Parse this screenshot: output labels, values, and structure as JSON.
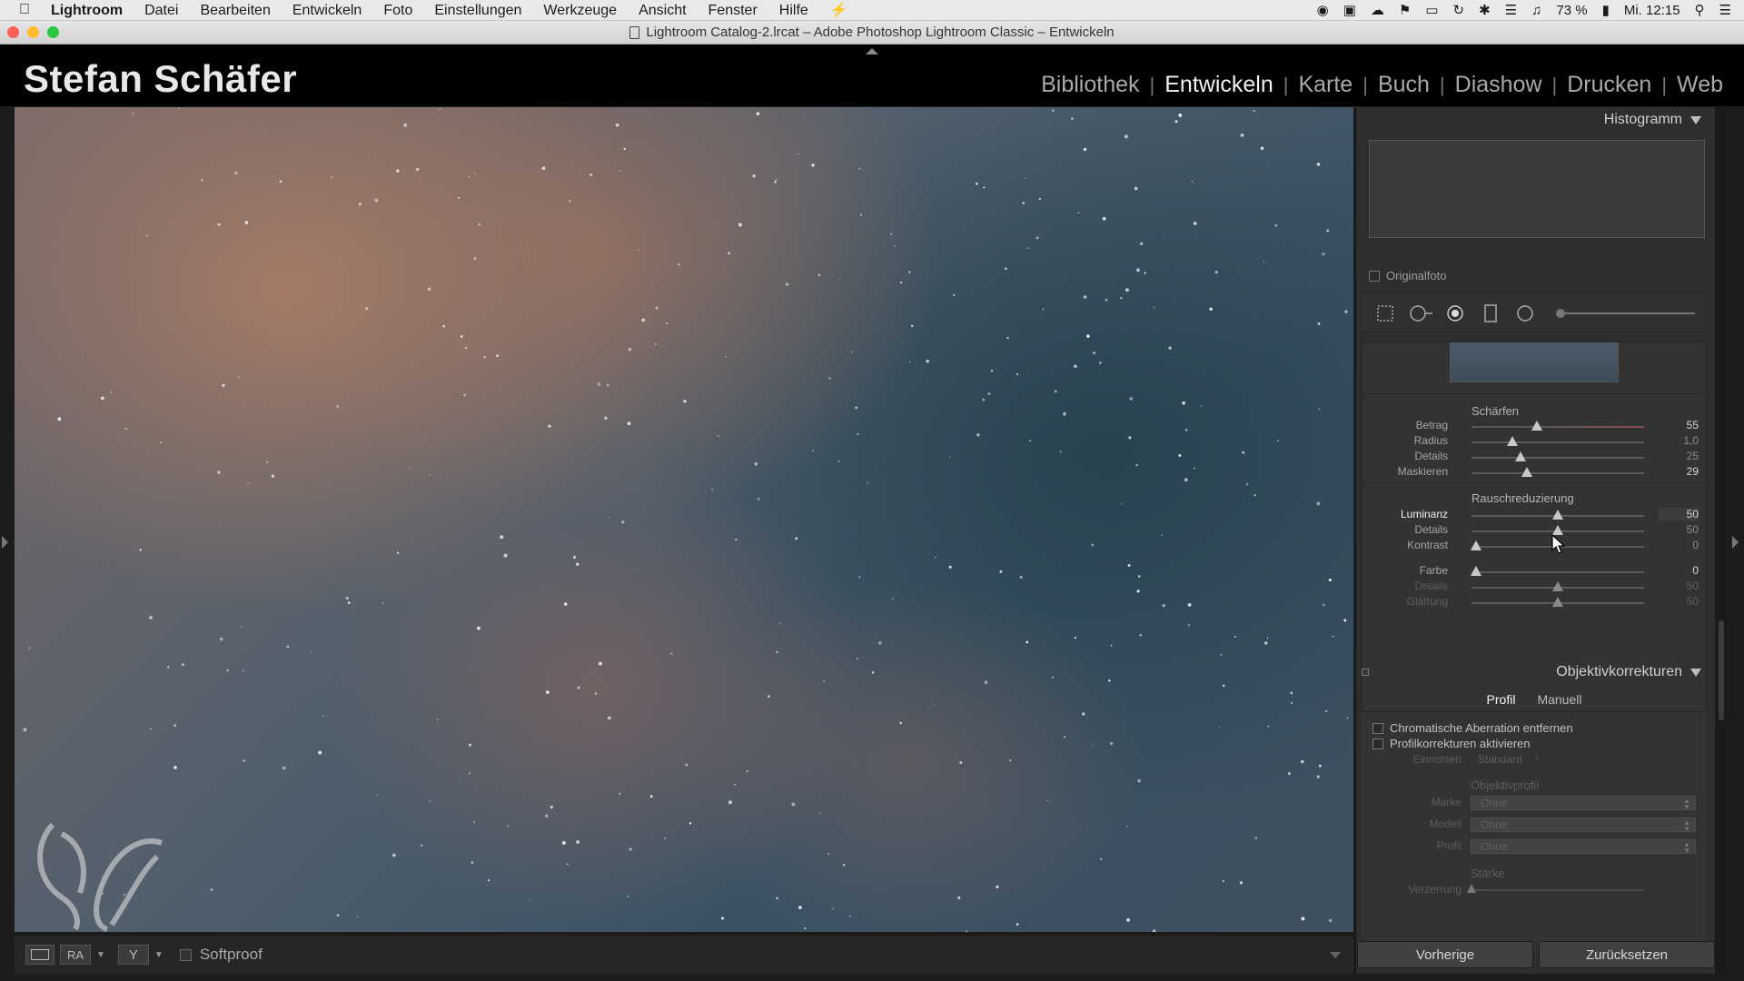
{
  "menubar": {
    "app": "Lightroom",
    "items": [
      "Datei",
      "Bearbeiten",
      "Entwickeln",
      "Foto",
      "Einstellungen",
      "Werkzeuge",
      "Ansicht",
      "Fenster",
      "Hilfe"
    ],
    "battery": "73 %",
    "clock": "Mi. 12:15"
  },
  "window": {
    "title": "Lightroom Catalog-2.lrcat – Adobe Photoshop Lightroom Classic – Entwickeln"
  },
  "identity_plate": "Stefan Schäfer",
  "modules": [
    {
      "label": "Bibliothek",
      "active": false
    },
    {
      "label": "Entwickeln",
      "active": true
    },
    {
      "label": "Karte",
      "active": false
    },
    {
      "label": "Buch",
      "active": false
    },
    {
      "label": "Diashow",
      "active": false
    },
    {
      "label": "Drucken",
      "active": false
    },
    {
      "label": "Web",
      "active": false
    }
  ],
  "toolbar": {
    "view_button": "RA",
    "softproof_label": "Softproof"
  },
  "histogram": {
    "header": "Histogramm",
    "original_photo_label": "Originalfoto"
  },
  "detail": {
    "sharpen_title": "Schärfen",
    "sharpen": [
      {
        "label": "Betrag",
        "value": "55",
        "pct": 0.37
      },
      {
        "label": "Radius",
        "value": "1,0",
        "pct": 0.22
      },
      {
        "label": "Details",
        "value": "25",
        "pct": 0.27
      },
      {
        "label": "Maskieren",
        "value": "29",
        "pct": 0.31
      }
    ],
    "noise_title": "Rauschreduzierung",
    "noise": [
      {
        "label": "Luminanz",
        "value": "50",
        "pct": 0.5
      },
      {
        "label": "Details",
        "value": "50",
        "pct": 0.5
      },
      {
        "label": "Kontrast",
        "value": "0",
        "pct": 0.0
      }
    ],
    "color": [
      {
        "label": "Farbe",
        "value": "0",
        "pct": 0.0
      },
      {
        "label": "Details",
        "value": "50",
        "pct": 0.5
      },
      {
        "label": "Glättung",
        "value": "50",
        "pct": 0.5
      }
    ]
  },
  "lens": {
    "header": "Objektivkorrekturen",
    "tab_profile": "Profil",
    "tab_manual": "Manuell",
    "chromatic_label": "Chromatische Aberration entfernen",
    "profile_enable_label": "Profilkorrekturen aktivieren",
    "setup_label": "Einrichten",
    "setup_value": "Standard",
    "profile_title": "Objektivprofil",
    "make_label": "Marke",
    "make_value": "Ohne",
    "model_label": "Modell",
    "model_value": "Ohne",
    "profile_label": "Profil",
    "profile_value": "Ohne",
    "amount_title": "Stärke",
    "distortion_label": "Verzerrung"
  },
  "buttons": {
    "previous": "Vorherige",
    "reset": "Zurücksetzen"
  }
}
